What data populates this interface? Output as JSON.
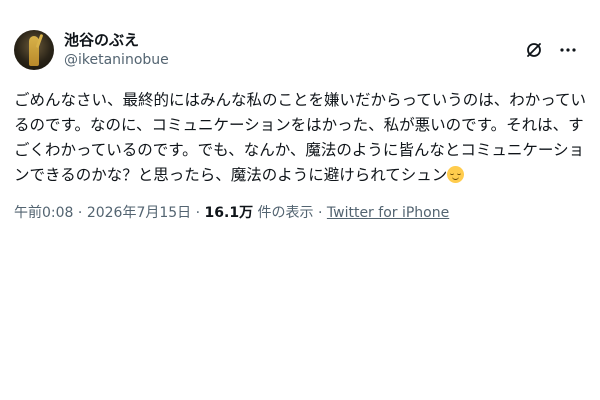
{
  "author": {
    "display_name": "池谷のぶえ",
    "handle": "@iketaninobue",
    "avatar_icon": "avatar-photo"
  },
  "header_actions": {
    "slash_icon": "no-link-icon",
    "more_icon": "more-icon"
  },
  "tweet": {
    "text": "ごめんなさい、最終的にはみんな私のことを嫌いだからっていうのは、わかっているのです。なのに、コミュニケーションをはかった、私が悪いのです。それは、すごくわかっているのです。でも、なんか、魔法のように皆んなとコミュニケーションできるのかな？と思ったら、魔法のように避けられてシュン",
    "emoji": "relieved-face-emoji"
  },
  "meta": {
    "time": "午前0:08",
    "separator": " · ",
    "date": "2026年7月15日",
    "views_count": "16.1万",
    "views_label": " 件の表示",
    "source": "Twitter for iPhone"
  },
  "colors": {
    "text": "#0f1419",
    "secondary": "#536471",
    "emoji": "#ffcc4d"
  }
}
